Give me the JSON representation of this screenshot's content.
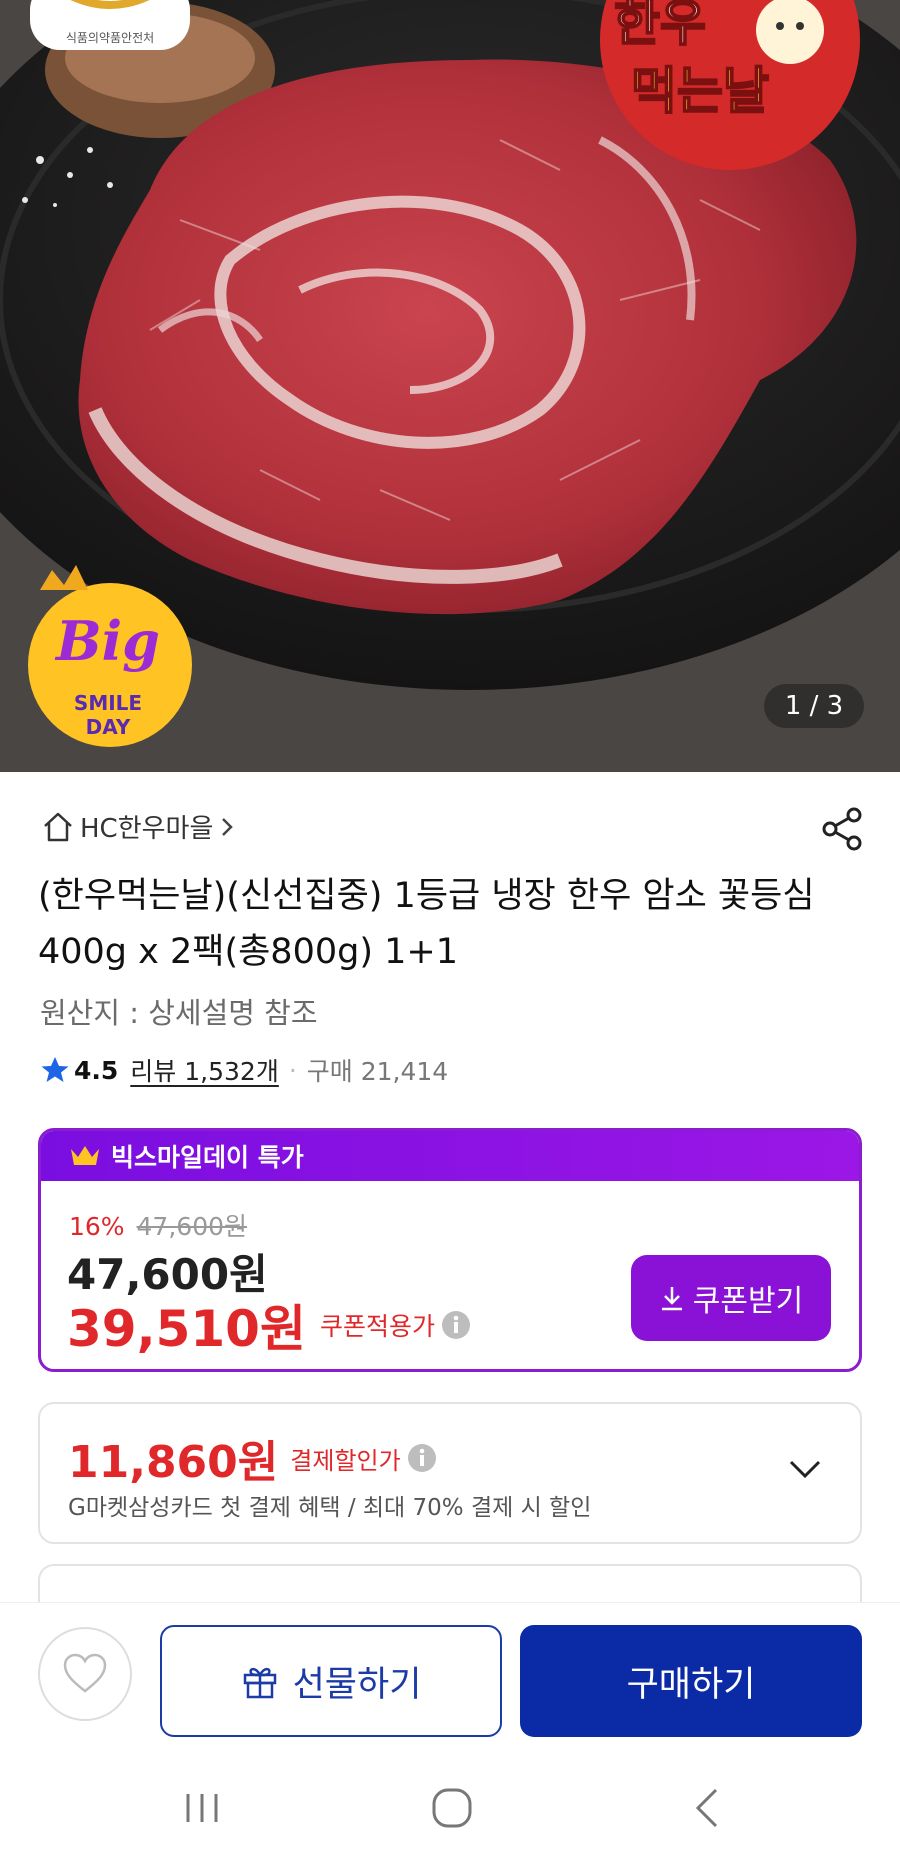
{
  "hero": {
    "image_counter": "1 / 3",
    "badge_top_right": [
      "한우",
      "먹는날"
    ],
    "badge_bottom_left": [
      "Big",
      "SMILE",
      "DAY"
    ],
    "badge_top_left": "식품의약품안전처"
  },
  "product": {
    "store_name": "HC한우마을",
    "title": "(한우먹는날)(신선집중) 1등급 냉장 한우 암소 꽃등심 400g x 2팩(총800g) 1+1",
    "origin": "원산지 : 상세설명 참조",
    "rating": "4.5",
    "review_link": "리뷰 1,532개",
    "separator": "·",
    "purchase_count": "구매 21,414"
  },
  "deal": {
    "header": "빅스마일데이 특가",
    "discount_pct": "16%",
    "original_price": "47,600원",
    "price": "47,600원",
    "coupon_price": "39,510원",
    "coupon_label": "쿠폰적용가",
    "coupon_button": "쿠폰받기"
  },
  "payment": {
    "price": "11,860원",
    "label": "결제할인가",
    "description": "G마켓삼성카드 첫 결제 혜택 / 최대 70% 결제 시 할인"
  },
  "actions": {
    "gift": "선물하기",
    "buy": "구매하기"
  },
  "colors": {
    "accent_purple": "#8a12d6",
    "price_red": "#e0282b",
    "buy_blue": "#0a2aa6"
  }
}
